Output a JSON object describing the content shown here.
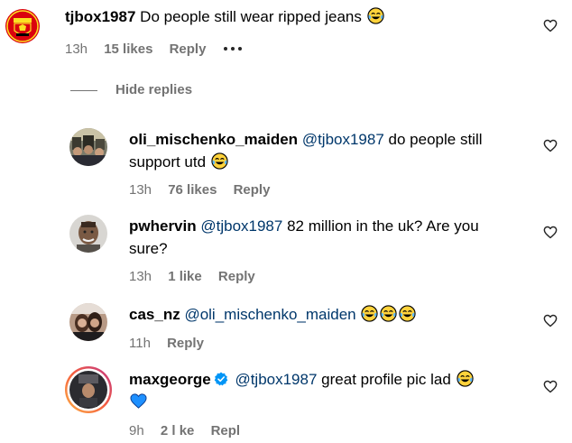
{
  "colors": {
    "mention": "#00376b",
    "meta_text": "#737373",
    "verified_blue": "#0095f6",
    "story_ring_start": "#fcaf45",
    "story_ring_end": "#c13584",
    "blue_heart": "#1e90ff"
  },
  "top_comment": {
    "username": "tjbox1987",
    "text": "Do people still wear ripped jeans",
    "emoji": "face-with-tears-of-joy",
    "time": "13h",
    "likes": "15 likes",
    "reply_label": "Reply",
    "more_icon": "more-horizontal-icon",
    "avatar": "manchester-united-crest"
  },
  "hide_replies_label": "Hide replies",
  "replies": [
    {
      "username": "oli_mischenko_maiden",
      "mention": "@tjbox1987",
      "text_line1": "do people still",
      "text_line2": "support utd",
      "emoji": "face-with-tears-of-joy",
      "time": "13h",
      "likes": "76 likes",
      "reply_label": "Reply"
    },
    {
      "username": "pwhervin",
      "mention": "@tjbox1987",
      "text_line1": "82 million in the uk? Are you",
      "text_line2": "sure?",
      "time": "13h",
      "likes": "1 like",
      "reply_label": "Reply"
    },
    {
      "username": "cas_nz",
      "mention": "@oli_mischenko_maiden",
      "emoji": "face-with-tears-of-joy x3",
      "time": "11h",
      "reply_label": "Reply"
    },
    {
      "username": "maxgeorge",
      "verified": true,
      "mention": "@tjbox1987",
      "text_line1": "great profile pic lad",
      "emoji_line1": "face-with-tears-of-joy",
      "emoji_line2": "blue-heart",
      "time": "9h",
      "likes": "2 l ke",
      "reply_label": "Repl"
    }
  ]
}
